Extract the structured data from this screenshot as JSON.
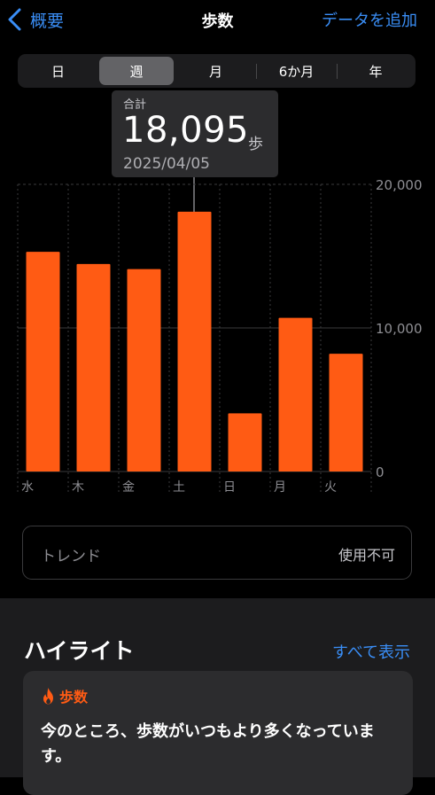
{
  "nav": {
    "back_label": "概要",
    "title": "歩数",
    "add_label": "データを追加"
  },
  "segments": [
    "日",
    "週",
    "月",
    "6か月",
    "年"
  ],
  "selected_segment": "週",
  "tooltip": {
    "label": "合計",
    "value": "18,095",
    "unit": "歩",
    "date": "2025/04/05"
  },
  "chart_data": {
    "type": "bar",
    "categories": [
      "水",
      "木",
      "金",
      "土",
      "日",
      "月",
      "火"
    ],
    "values": [
      15300,
      14450,
      14100,
      18095,
      4050,
      10700,
      8200
    ],
    "highlighted_index": 3,
    "ylim": [
      0,
      20000
    ],
    "yticks": [
      0,
      10000,
      20000
    ],
    "ytick_labels": [
      "0",
      "10,000",
      "20,000"
    ],
    "bar_color": "#ff5b14",
    "grid": true
  },
  "trend": {
    "label": "トレンド",
    "status": "使用不可"
  },
  "highlights": {
    "title": "ハイライト",
    "show_all": "すべて表示",
    "card": {
      "icon": "flame-icon",
      "name": "歩数",
      "text": "今のところ、歩数がいつもより多くなっています。"
    }
  }
}
